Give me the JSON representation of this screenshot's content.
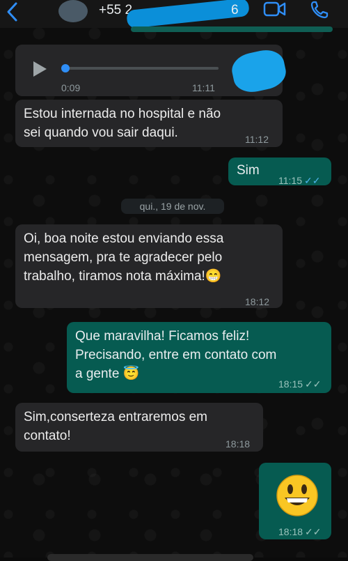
{
  "header": {
    "back_icon": "chevron-left-icon",
    "contact_name": "+55 2",
    "contact_name_suffix": "6",
    "video_icon": "video-call-icon",
    "call_icon": "phone-icon"
  },
  "audio_message": {
    "duration": "0:09",
    "time": "11:11",
    "play_icon": "play-icon"
  },
  "messages": [
    {
      "lines": [
        "Estou internada no hospital e não",
        "sei quando vou sair daqui."
      ],
      "time": "11:12"
    },
    {
      "lines": [
        "Sim"
      ],
      "time": "11:15",
      "ticks": "✓✓"
    },
    {
      "lines": [
        "Oi, boa noite estou enviando essa",
        "mensagem, pra te agradecer pelo",
        "trabalho, tiramos nota máxima!😁"
      ],
      "time": "18:12"
    },
    {
      "lines": [
        "Que maravilha! Ficamos feliz!",
        "Precisando, entre em contato com",
        "a gente 😇"
      ],
      "time": "18:15",
      "ticks": "✓✓"
    },
    {
      "lines": [
        "Sim,conserteza entraremos em",
        "contato!"
      ],
      "time": "18:18"
    },
    {
      "emoji": "😃",
      "time": "18:18",
      "ticks": "✓✓"
    }
  ],
  "date_separator": "qui., 19 de nov.",
  "colors": {
    "incoming_bubble": "#262628",
    "outgoing_bubble": "#065b51",
    "accent": "#2f8ef7",
    "read_ticks": "#4fb6ec"
  }
}
